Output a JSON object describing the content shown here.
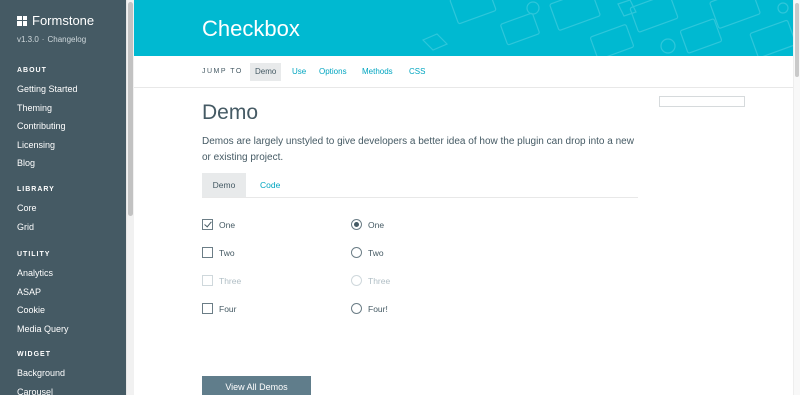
{
  "brand": {
    "name": "Formstone",
    "version": "v1.3.0",
    "changelog": "Changelog"
  },
  "sidebar": {
    "sections": [
      {
        "heading": "ABOUT",
        "items": [
          "Getting Started",
          "Theming",
          "Contributing",
          "Licensing",
          "Blog"
        ]
      },
      {
        "heading": "LIBRARY",
        "items": [
          "Core",
          "Grid"
        ]
      },
      {
        "heading": "UTILITY",
        "items": [
          "Analytics",
          "ASAP",
          "Cookie",
          "Media Query"
        ]
      },
      {
        "heading": "WIDGET",
        "items": [
          "Background",
          "Carousel"
        ]
      }
    ]
  },
  "header": {
    "title": "Checkbox"
  },
  "jumpbar": {
    "label": "JUMP TO",
    "links": [
      "Demo",
      "Use",
      "Options",
      "Methods",
      "CSS"
    ],
    "active": "Demo"
  },
  "main": {
    "title": "Demo",
    "description": "Demos are largely unstyled to give developers a better idea of how the plugin can drop into a new or existing project.",
    "tabs": [
      "Demo",
      "Code"
    ],
    "checkboxes": [
      {
        "label": "One",
        "checked": true,
        "disabled": false
      },
      {
        "label": "Two",
        "checked": false,
        "disabled": false
      },
      {
        "label": "Three",
        "checked": false,
        "disabled": true
      },
      {
        "label": "Four",
        "checked": false,
        "disabled": false
      }
    ],
    "radios": [
      {
        "label": "One",
        "checked": true,
        "disabled": false
      },
      {
        "label": "Two",
        "checked": false,
        "disabled": false
      },
      {
        "label": "Three",
        "checked": false,
        "disabled": true
      },
      {
        "label": "Four!",
        "checked": false,
        "disabled": false
      }
    ],
    "view_all_label": "View All Demos"
  },
  "colors": {
    "sidebar": "#455a64",
    "header": "#00b9d1",
    "link": "#00a5c0",
    "button": "#607d8b"
  }
}
